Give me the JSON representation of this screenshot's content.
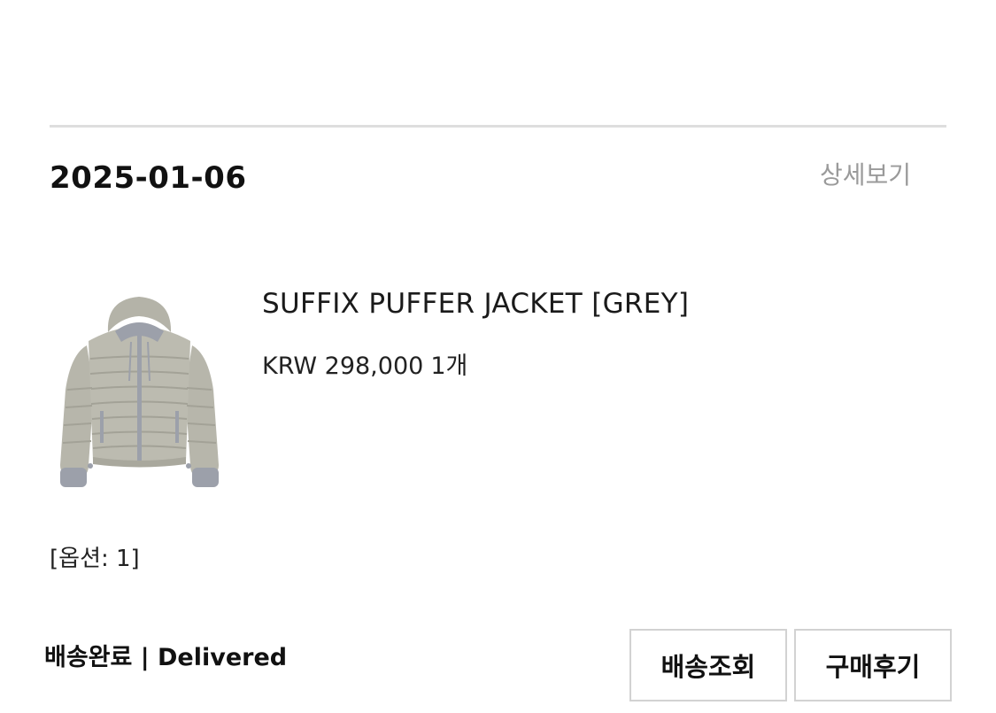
{
  "order": {
    "date": "2025-01-06",
    "detail_link": "상세보기",
    "product": {
      "name": "SUFFIX PUFFER JACKET [GREY]",
      "price": "KRW 298,000",
      "quantity": "1개",
      "option": "[옵션: 1]",
      "image_icon": "jacket-image"
    },
    "status": "배송완료 | Delivered",
    "buttons": {
      "track": "배송조회",
      "review": "구매후기"
    }
  },
  "colors": {
    "divider": "#dedede",
    "muted_text": "#9a9a9a",
    "button_border": "#d2d2d2",
    "jacket_body": "#b9b8ad",
    "jacket_trim": "#9ca0aa"
  }
}
